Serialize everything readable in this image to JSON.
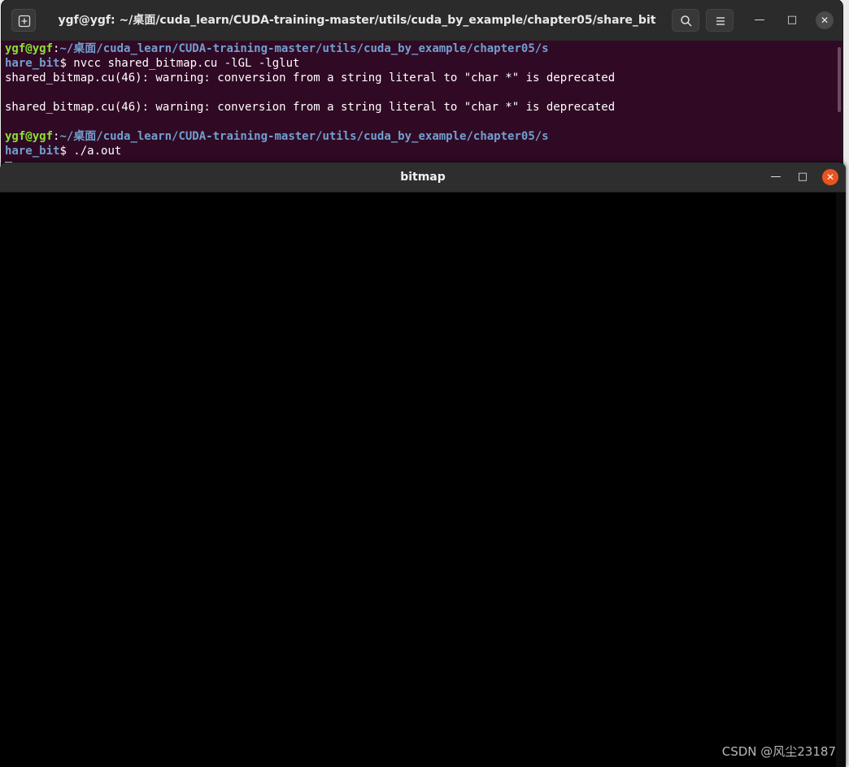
{
  "terminal": {
    "title": "ygf@ygf: ~/桌面/cuda_learn/CUDA-training-master/utils/cuda_by_example/chapter05/share_bit",
    "lines": [
      {
        "user": "ygf@ygf",
        "sep": ":",
        "path": "~/桌面/cuda_learn/CUDA-training-master/utils/cuda_by_example/chapter05/s",
        "text": ""
      },
      {
        "user": "",
        "sep": "",
        "path": "hare_bit",
        "text": "$ nvcc shared_bitmap.cu -lGL -lglut"
      },
      {
        "user": "",
        "sep": "",
        "path": "",
        "text": "shared_bitmap.cu(46): warning: conversion from a string literal to \"char *\" is deprecated"
      },
      {
        "user": "",
        "sep": "",
        "path": "",
        "text": ""
      },
      {
        "user": "",
        "sep": "",
        "path": "",
        "text": "shared_bitmap.cu(46): warning: conversion from a string literal to \"char *\" is deprecated"
      },
      {
        "user": "",
        "sep": "",
        "path": "",
        "text": ""
      },
      {
        "user": "ygf@ygf",
        "sep": ":",
        "path": "~/桌面/cuda_learn/CUDA-training-master/utils/cuda_by_example/chapter05/s",
        "text": ""
      },
      {
        "user": "",
        "sep": "",
        "path": "hare_bit",
        "text": "$ ./a.out"
      }
    ],
    "icons": {
      "new_tab": "new-tab-icon",
      "search": "search-icon",
      "menu": "hamburger-menu-icon",
      "minimize": "minimize-icon",
      "maximize": "maximize-icon",
      "close": "close-icon"
    },
    "colors": {
      "background": "#300a24",
      "user": "#8ae234",
      "path": "#729fcf"
    }
  },
  "bitmap_window": {
    "title": "bitmap",
    "colors": {
      "cell": "#00ff00",
      "background": "#000000",
      "close": "#e95420"
    }
  },
  "watermark": "CSDN @风尘23187"
}
